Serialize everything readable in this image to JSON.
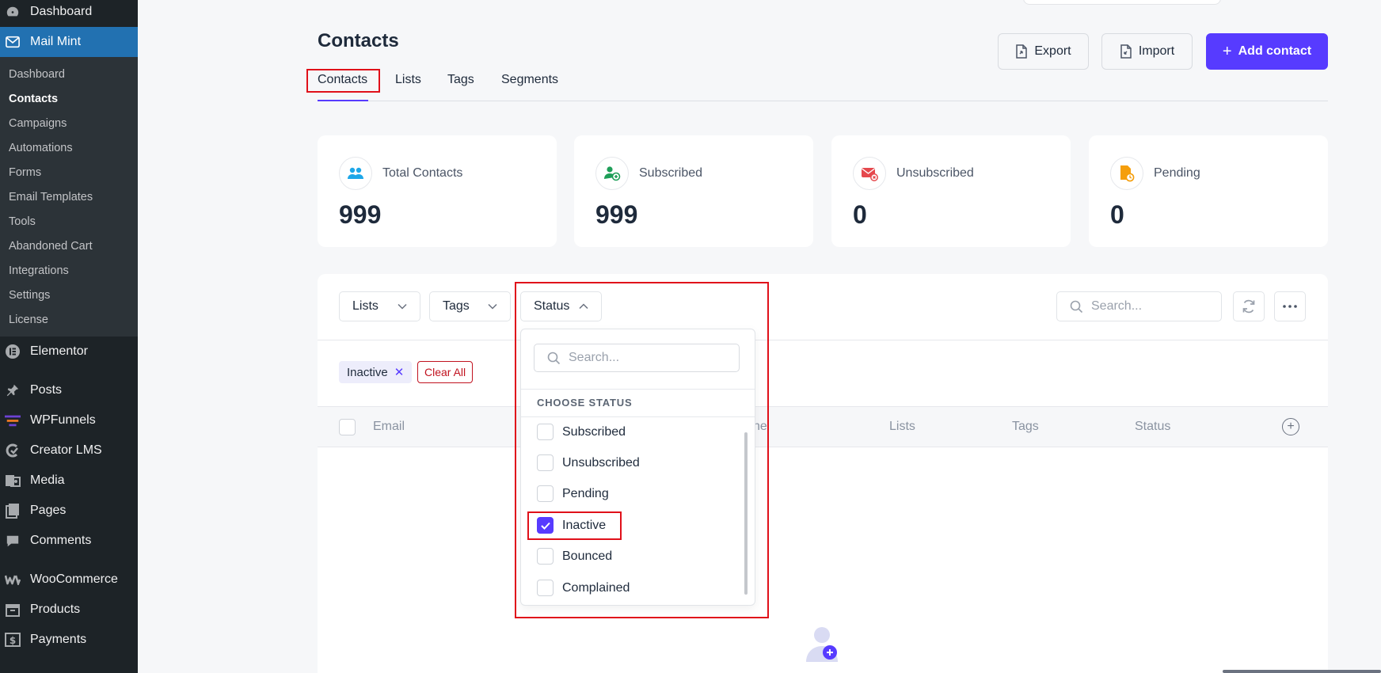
{
  "sidebar": {
    "top_items": [
      {
        "label": "Dashboard",
        "icon": "dashboard-icon"
      },
      {
        "label": "Mail Mint",
        "icon": "mail-icon"
      }
    ],
    "submenu": [
      "Dashboard",
      "Contacts",
      "Campaigns",
      "Automations",
      "Forms",
      "Email Templates",
      "Tools",
      "Abandoned Cart",
      "Integrations",
      "Settings",
      "License"
    ],
    "items": [
      {
        "label": "Elementor",
        "icon": "elementor-icon"
      },
      {
        "label": "Posts",
        "icon": "pin-icon"
      },
      {
        "label": "WPFunnels",
        "icon": "funnel-icon"
      },
      {
        "label": "Creator LMS",
        "icon": "lms-icon"
      },
      {
        "label": "Media",
        "icon": "media-icon"
      },
      {
        "label": "Pages",
        "icon": "pages-icon"
      },
      {
        "label": "Comments",
        "icon": "comment-icon"
      },
      {
        "label": "WooCommerce",
        "icon": "woo-icon"
      },
      {
        "label": "Products",
        "icon": "box-icon"
      },
      {
        "label": "Payments",
        "icon": "dollar-icon"
      }
    ]
  },
  "header": {
    "title": "Contacts",
    "export_label": "Export",
    "import_label": "Import",
    "add_label": "Add contact"
  },
  "tabs": [
    "Contacts",
    "Lists",
    "Tags",
    "Segments"
  ],
  "stats": [
    {
      "label": "Total Contacts",
      "value": "999",
      "icon": "users-icon",
      "color": "#1ea7e8"
    },
    {
      "label": "Subscribed",
      "value": "999",
      "icon": "user-check-icon",
      "color": "#1e9e58"
    },
    {
      "label": "Unsubscribed",
      "value": "0",
      "icon": "mail-x-icon",
      "color": "#e5484d"
    },
    {
      "label": "Pending",
      "value": "0",
      "icon": "file-clock-icon",
      "color": "#f59e0b"
    }
  ],
  "filters": {
    "lists_label": "Lists",
    "tags_label": "Tags",
    "status_label": "Status",
    "search_placeholder": "Search..."
  },
  "active_filters": {
    "chip_label": "Inactive",
    "clear_label": "Clear All"
  },
  "table": {
    "columns": [
      "Email",
      "ne",
      "Lists",
      "Tags",
      "Status"
    ]
  },
  "status_dropdown": {
    "search_placeholder": "Search...",
    "heading": "CHOOSE STATUS",
    "options": [
      {
        "label": "Subscribed",
        "checked": false
      },
      {
        "label": "Unsubscribed",
        "checked": false
      },
      {
        "label": "Pending",
        "checked": false
      },
      {
        "label": "Inactive",
        "checked": true
      },
      {
        "label": "Bounced",
        "checked": false
      },
      {
        "label": "Complained",
        "checked": false
      }
    ]
  },
  "colors": {
    "primary": "#573bff",
    "wp_sidebar": "#1d2327",
    "wp_active": "#2271b1",
    "highlight": "#e0101a"
  }
}
